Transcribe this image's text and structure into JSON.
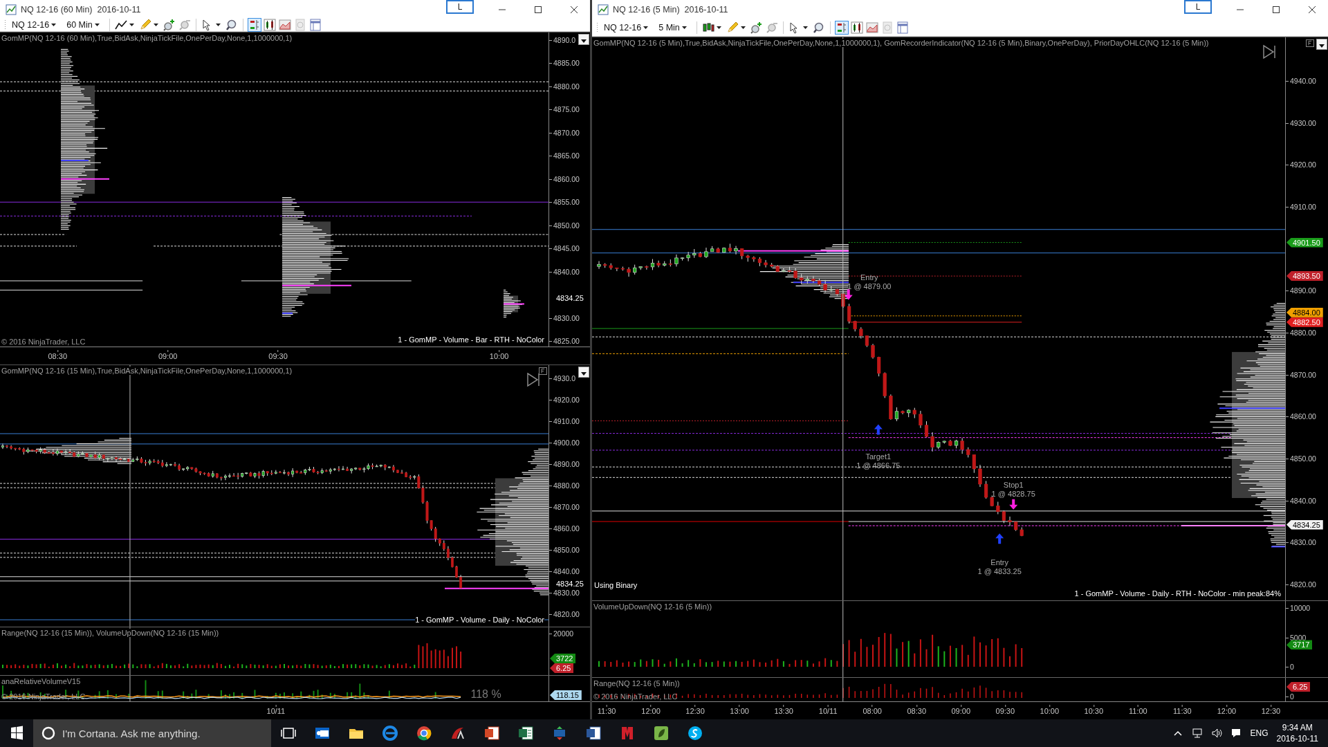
{
  "windows": [
    {
      "title": "NQ 12-16 (60 Min)  2016-10-11",
      "link_button": "L",
      "toolbar": {
        "instrument": "NQ 12-16",
        "interval": "60 Min",
        "candlestick_style": false
      },
      "charts": [
        {
          "kind": "volume_profile",
          "panes": [
            {
              "kind": "price",
              "label": "GomMP(NQ 12-16 (60 Min),True,BidAsk,NinjaTickFile,OnePerDay,None,1,1000000,1)",
              "legend": "1 - GomMP  - Volume - Bar - RTH - NoColor",
              "copyright": "© 2016 NinjaTrader, LLC",
              "ticks": [
                "4890.0",
                "4885.00",
                "4880.00",
                "4875.00",
                "4870.00",
                "4865.00",
                "4860.00",
                "4855.00",
                "4850.00",
                "4845.00",
                "4840.00",
                "4830.00",
                "4825.00"
              ],
              "badges": [
                {
                  "text": "4834.25",
                  "color": "#000000"
                }
              ]
            }
          ],
          "time_ticks": [
            "08:30",
            "09:00",
            "09:30",
            "10:00"
          ]
        },
        {
          "kind": "candlestick",
          "panes": [
            {
              "kind": "price",
              "label": "GomMP(NQ 12-16 (15 Min),True,BidAsk,NinjaTickFile,OnePerDay,None,1,1000000,1)",
              "legend": "1 - GomMP  - Volume - Daily - NoColor",
              "ticks": [
                "4930.0",
                "4920.00",
                "4910.00",
                "4900.00",
                "4890.00",
                "4880.00",
                "4870.00",
                "4860.00",
                "4850.00",
                "4840.00",
                "4830.00",
                "4820.00"
              ],
              "badges": [
                {
                  "text": "4834.25",
                  "color": "#000000"
                }
              ]
            },
            {
              "kind": "volume",
              "label": "Range(NQ 12-16 (15 Min)), VolumeUpDown(NQ 12-16 (15 Min))",
              "ticks": [
                "20000"
              ],
              "badges": [
                {
                  "text": "3722",
                  "color": "#138a13"
                },
                {
                  "text": "6.25",
                  "color": "#c0202a"
                }
              ]
            },
            {
              "kind": "relative_volume",
              "label": "anaRelativeVolumeV15",
              "copyright": "© 2016 NinjaTrader, LLC",
              "reading": "118 %",
              "badges": [
                {
                  "text": "118.15",
                  "color": "#add8ef"
                }
              ]
            }
          ],
          "time_ticks": [
            "10/11"
          ]
        }
      ]
    },
    {
      "title": "NQ 12-16 (5 Min)  2016-10-11",
      "link_button": "L",
      "toolbar": {
        "instrument": "NQ 12-16",
        "interval": "5 Min",
        "candlestick_style": true
      },
      "charts": [
        {
          "kind": "candlestick",
          "panes": [
            {
              "kind": "price",
              "label": "GomMP(NQ 12-16 (5 Min),True,BidAsk,NinjaTickFile,OnePerDay,None,1,1000000,1), GomRecorderIndicator(NQ 12-16 (5 Min),Binary,OnePerDay), PriorDayOHLC(NQ 12-16 (5 Min))",
              "legend": "1 - GomMP  - Volume - Daily - RTH - NoColor - min peak:84%",
              "note": "Using Binary",
              "ticks": [
                "4940.00",
                "4930.00",
                "4920.00",
                "4910.00",
                "4890.00",
                "4880.00",
                "4870.00",
                "4860.00",
                "4850.00",
                "4840.00",
                "4830.00",
                "4820.00"
              ],
              "badges": [
                {
                  "text": "4901.50",
                  "color": "#1a9c1a"
                },
                {
                  "text": "4893.50",
                  "color": "#c0202a"
                },
                {
                  "text": "4884.00",
                  "color": "#f0a000"
                },
                {
                  "text": "4882.50",
                  "color": "#e02020"
                },
                {
                  "text": "4834.25",
                  "color": "#f0f0f0"
                }
              ],
              "orders": [
                {
                  "label": "Entry",
                  "detail": "1 @ 4879.00",
                  "sell": true
                },
                {
                  "label": "Target1",
                  "detail": "1 @ 4866.75",
                  "sell": false
                },
                {
                  "label": "Stop1",
                  "detail": "1 @ 4828.75",
                  "sell": true
                },
                {
                  "label": "Entry",
                  "detail": "1 @ 4833.25",
                  "sell": false
                }
              ]
            },
            {
              "kind": "volume",
              "label": "VolumeUpDown(NQ 12-16 (5 Min))",
              "ticks": [
                "10000",
                "5000",
                "0"
              ],
              "badges": [
                {
                  "text": "3717",
                  "color": "#138a13"
                }
              ]
            },
            {
              "kind": "range",
              "label": "Range(NQ 12-16 (5 Min))",
              "copyright": "© 2016 NinjaTrader, LLC",
              "ticks": [
                "0"
              ],
              "badges": [
                {
                  "text": "6.25",
                  "color": "#c0202a"
                }
              ]
            }
          ],
          "time_ticks": [
            "11:30",
            "12:00",
            "12:30",
            "13:00",
            "13:30",
            "10/11",
            "08:00",
            "08:30",
            "09:00",
            "09:30",
            "10:00",
            "10:30",
            "11:00",
            "11:30",
            "12:00",
            "12:30"
          ]
        }
      ]
    }
  ],
  "taskbar": {
    "search": {
      "placeholder": "I'm Cortana. Ask me anything."
    },
    "language": "ENG",
    "time": "9:34 AM",
    "date": "2016-10-11"
  }
}
